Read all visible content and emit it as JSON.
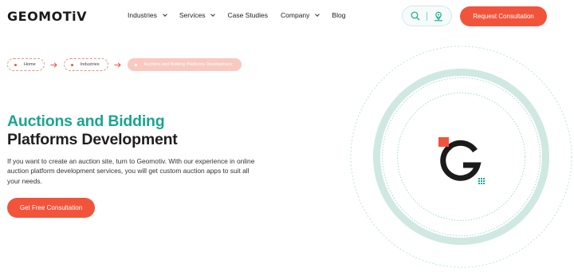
{
  "header": {
    "logo": "GEOMOTiV",
    "nav": [
      {
        "label": "Industries",
        "has_dropdown": true
      },
      {
        "label": "Services",
        "has_dropdown": true
      },
      {
        "label": "Case Studies",
        "has_dropdown": false
      },
      {
        "label": "Company",
        "has_dropdown": true
      },
      {
        "label": "Blog",
        "has_dropdown": false
      }
    ],
    "tools": {
      "search_icon": "search-icon",
      "account_icon": "user-location-icon"
    },
    "cta_label": "Request Consultation"
  },
  "breadcrumb": [
    {
      "label": "Home",
      "active": false
    },
    {
      "label": "Industries",
      "active": false
    },
    {
      "label": "Auctions and Bidding Platforms Development",
      "active": true
    }
  ],
  "hero": {
    "title_line1": "Auctions and Bidding",
    "title_line2": "Platforms Development",
    "description": "If you want to create an auction site, turn to Geomotiv. With our experience in online auction platform development services, you will get custom auction apps to suit all your needs.",
    "cta_label": "Get Free Consultation"
  },
  "colors": {
    "accent_teal": "#1ba58e",
    "accent_orange": "#f2543b",
    "light_teal": "#d3ece6",
    "dark_text": "#1f1f1f"
  }
}
